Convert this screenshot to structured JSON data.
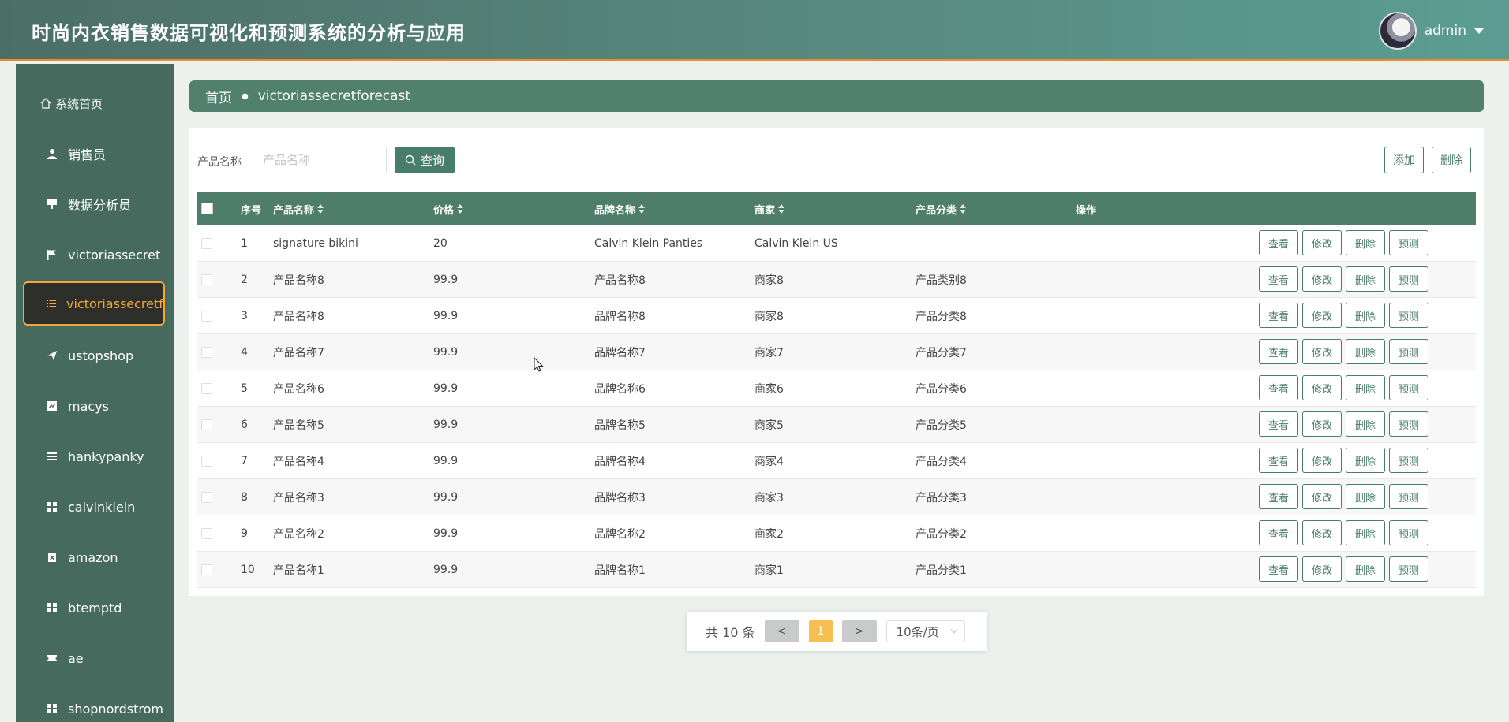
{
  "header": {
    "title": "时尚内衣销售数据可视化和预测系统的分析与应用",
    "username": "admin"
  },
  "sidebar": {
    "items": [
      {
        "label": "系统首页",
        "icon": "home-icon"
      },
      {
        "label": "销售员",
        "icon": "user-icon"
      },
      {
        "label": "数据分析员",
        "icon": "presentation-icon"
      },
      {
        "label": "victoriassecret",
        "icon": "flag-icon"
      },
      {
        "label": "victoriassecretforecast",
        "icon": "list-icon",
        "active": true
      },
      {
        "label": "ustopshop",
        "icon": "send-icon"
      },
      {
        "label": "macys",
        "icon": "chart-icon"
      },
      {
        "label": "hankypanky",
        "icon": "bars-icon"
      },
      {
        "label": "calvinklein",
        "icon": "grid-icon"
      },
      {
        "label": "amazon",
        "icon": "box-icon"
      },
      {
        "label": "btemptd",
        "icon": "grid-icon"
      },
      {
        "label": "ae",
        "icon": "ticket-icon"
      },
      {
        "label": "shopnordstrom",
        "icon": "grid-icon"
      }
    ]
  },
  "breadcrumb": {
    "home": "首页",
    "current": "victoriassecretforecast"
  },
  "search": {
    "label": "产品名称",
    "placeholder": "产品名称",
    "value": "",
    "button": "查询"
  },
  "toolbar": {
    "add": "添加",
    "delete": "删除"
  },
  "table": {
    "headers": {
      "index": "序号",
      "product": "产品名称",
      "price": "价格",
      "brand": "品牌名称",
      "merchant": "商家",
      "category": "产品分类",
      "actions": "操作"
    },
    "rows": [
      {
        "index": "1",
        "product": "signature bikini",
        "price": "20",
        "brand": "Calvin Klein Panties",
        "merchant": "Calvin Klein US",
        "category": ""
      },
      {
        "index": "2",
        "product": "产品名称8",
        "price": "99.9",
        "brand": "产品名称8",
        "merchant": "商家8",
        "category": "产品类别8"
      },
      {
        "index": "3",
        "product": "产品名称8",
        "price": "99.9",
        "brand": "品牌名称8",
        "merchant": "商家8",
        "category": "产品分类8"
      },
      {
        "index": "4",
        "product": "产品名称7",
        "price": "99.9",
        "brand": "品牌名称7",
        "merchant": "商家7",
        "category": "产品分类7"
      },
      {
        "index": "5",
        "product": "产品名称6",
        "price": "99.9",
        "brand": "品牌名称6",
        "merchant": "商家6",
        "category": "产品分类6"
      },
      {
        "index": "6",
        "product": "产品名称5",
        "price": "99.9",
        "brand": "品牌名称5",
        "merchant": "商家5",
        "category": "产品分类5"
      },
      {
        "index": "7",
        "product": "产品名称4",
        "price": "99.9",
        "brand": "品牌名称4",
        "merchant": "商家4",
        "category": "产品分类4"
      },
      {
        "index": "8",
        "product": "产品名称3",
        "price": "99.9",
        "brand": "品牌名称3",
        "merchant": "商家3",
        "category": "产品分类3"
      },
      {
        "index": "9",
        "product": "产品名称2",
        "price": "99.9",
        "brand": "品牌名称2",
        "merchant": "商家2",
        "category": "产品分类2"
      },
      {
        "index": "10",
        "product": "产品名称1",
        "price": "99.9",
        "brand": "品牌名称1",
        "merchant": "商家1",
        "category": "产品分类1"
      }
    ],
    "row_actions": {
      "view": "查看",
      "edit": "修改",
      "delete": "删除",
      "predict": "预测"
    }
  },
  "pagination": {
    "total": "共 10 条",
    "prev": "<",
    "current": "1",
    "next": ">",
    "page_size": "10条/页"
  },
  "colors": {
    "header_start": "#4b6f66",
    "header_end": "#5b9d94",
    "accent_orange": "#f08a24",
    "sidebar": "#466a5e",
    "primary": "#497d6b",
    "page_active": "#f6bf52"
  }
}
